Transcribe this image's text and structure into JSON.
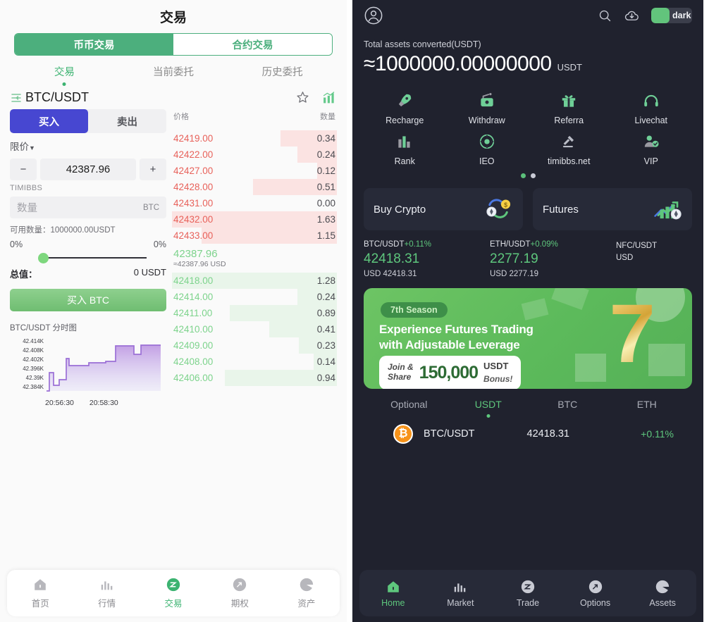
{
  "left": {
    "title": "交易",
    "segments": [
      {
        "label": "币币交易",
        "active": true
      },
      {
        "label": "合约交易",
        "active": false
      }
    ],
    "subtabs": [
      {
        "label": "交易",
        "active": true
      },
      {
        "label": "当前委托",
        "active": false
      },
      {
        "label": "历史委托",
        "active": false
      }
    ],
    "pair": "BTC/USDT",
    "icons": {
      "back": "back-arrow-icon",
      "favorite": "star-outline-icon",
      "kline": "kline-chart-icon"
    },
    "form": {
      "buy_label": "买入",
      "sell_label": "卖出",
      "order_type": "限价",
      "minus": "−",
      "plus": "+",
      "price_value": "42387.96",
      "brand": "TIMIBBS",
      "qty_placeholder": "数量",
      "qty_unit": "BTC",
      "available_label": "可用数量：1000000.00USDT",
      "pct_left": "0%",
      "pct_right": "0%",
      "total_label": "总值：",
      "total_value": "0 USDT",
      "cta": "买入 BTC"
    },
    "chart": {
      "title": "BTC/USDT 分时图",
      "time_labels": [
        "20:56:30",
        "20:58:30"
      ]
    },
    "orderbook": {
      "head_price": "价格",
      "head_qty": "数量",
      "asks": [
        {
          "price": "42419.00",
          "qty": "0.34",
          "depth": 34
        },
        {
          "price": "42422.00",
          "qty": "0.24",
          "depth": 24
        },
        {
          "price": "42427.00",
          "qty": "0.12",
          "depth": 12
        },
        {
          "price": "42428.00",
          "qty": "0.51",
          "depth": 51
        },
        {
          "price": "42431.00",
          "qty": "0.00",
          "depth": 0
        },
        {
          "price": "42432.00",
          "qty": "1.63",
          "depth": 100
        },
        {
          "price": "42433.00",
          "qty": "1.15",
          "depth": 82
        }
      ],
      "mid_price": "42387.96",
      "mid_usd": "≈42387.96 USD",
      "bids": [
        {
          "price": "42418.00",
          "qty": "1.28",
          "depth": 100
        },
        {
          "price": "42414.00",
          "qty": "0.24",
          "depth": 24
        },
        {
          "price": "42411.00",
          "qty": "0.89",
          "depth": 65
        },
        {
          "price": "42410.00",
          "qty": "0.41",
          "depth": 41
        },
        {
          "price": "42409.00",
          "qty": "0.23",
          "depth": 23
        },
        {
          "price": "42408.00",
          "qty": "0.14",
          "depth": 14
        },
        {
          "price": "42406.00",
          "qty": "0.94",
          "depth": 68
        }
      ]
    },
    "bottom_nav": [
      {
        "label": "首页",
        "icon": "home-icon",
        "active": false
      },
      {
        "label": "行情",
        "icon": "bars-chart-icon",
        "active": false
      },
      {
        "label": "交易",
        "icon": "trade-circle-icon",
        "active": true
      },
      {
        "label": "期权",
        "icon": "options-arrow-icon",
        "active": false
      },
      {
        "label": "资产",
        "icon": "pie-chart-icon",
        "active": false
      }
    ]
  },
  "right": {
    "topbar": {
      "avatar": "user-avatar-icon",
      "search": "search-icon",
      "download": "download-cloud-icon",
      "theme_label": "dark"
    },
    "assets": {
      "label": "Total assets converted(USDT)",
      "value": "≈1000000.00000000",
      "unit": "USDT"
    },
    "quick_actions": [
      {
        "label": "Recharge",
        "icon": "rocket-icon"
      },
      {
        "label": "Withdraw",
        "icon": "withdraw-wallet-icon"
      },
      {
        "label": "Referra",
        "icon": "gift-icon"
      },
      {
        "label": "Livechat",
        "icon": "headset-icon"
      },
      {
        "label": "Rank",
        "icon": "rank-bars-icon"
      },
      {
        "label": "IEO",
        "icon": "atom-icon"
      },
      {
        "label": "timibbs.net",
        "icon": "gavel-icon"
      },
      {
        "label": "VIP",
        "icon": "vip-user-icon"
      }
    ],
    "carousel_dots": [
      true,
      false
    ],
    "cards": [
      {
        "title": "Buy Crypto",
        "icon": "swap-coins-icon"
      },
      {
        "title": "Futures",
        "icon": "futures-growth-icon"
      }
    ],
    "tickers": [
      {
        "pair": "BTC/USDT",
        "change": "+0.11%",
        "price": "42418.31",
        "sub": "USD 42418.31"
      },
      {
        "pair": "ETH/USDT",
        "change": "+0.09%",
        "price": "2277.19",
        "sub": "USD 2277.19"
      },
      {
        "pair": "NFC/USDT",
        "change": "",
        "price": "",
        "sub": "USD"
      }
    ],
    "banner": {
      "badge": "7th Season",
      "headline_line1": "Experience Futures Trading",
      "headline_line2": "with Adjustable Leverage",
      "join": "Join &",
      "share": "Share",
      "amount": "150,000",
      "usdt": "USDT",
      "bonus": "Bonus!",
      "seven": "7"
    },
    "market_tabs": [
      {
        "label": "Optional",
        "active": false
      },
      {
        "label": "USDT",
        "active": true
      },
      {
        "label": "BTC",
        "active": false
      },
      {
        "label": "ETH",
        "active": false
      }
    ],
    "coins": [
      {
        "symbol": "₿",
        "name": "BTC/USDT",
        "price": "42418.31",
        "change": "+0.11%"
      }
    ],
    "bottom_nav": [
      {
        "label": "Home",
        "icon": "home-icon",
        "active": true
      },
      {
        "label": "Market",
        "icon": "bars-chart-icon",
        "active": false
      },
      {
        "label": "Trade",
        "icon": "trade-circle-icon",
        "active": false
      },
      {
        "label": "Options",
        "icon": "options-arrow-icon",
        "active": false
      },
      {
        "label": "Assets",
        "icon": "pie-chart-icon",
        "active": false
      }
    ]
  },
  "colors": {
    "green": "#3cb371",
    "accent_green": "#5ec77d",
    "buy_blue": "#4747d1",
    "ask_red": "#e8625b",
    "dark_bg": "#20222e",
    "card_bg": "#272a38",
    "chart_line": "#9b6fd6"
  },
  "chart_data": {
    "type": "area",
    "title": "BTC/USDT 分时图",
    "ylabel": "",
    "xlabel": "",
    "y_ticks": [
      "42.384K",
      "42.39K",
      "42.396K",
      "42.402K",
      "42.408K",
      "42.414K"
    ],
    "x_ticks": [
      "20:56:30",
      "20:58:30"
    ],
    "ylim": [
      42.381,
      42.417
    ],
    "grid": false,
    "legend": "none",
    "series": [
      {
        "name": "BTC/USDT price",
        "values": [
          42.384,
          42.3845,
          42.392,
          42.392,
          42.386,
          42.386,
          42.389,
          42.389,
          42.4035,
          42.4005,
          42.4005,
          42.4005,
          42.4025,
          42.4025,
          42.4025,
          42.4035,
          42.4035,
          42.414,
          42.414,
          42.4075,
          42.4075,
          42.4145,
          42.4145
        ]
      }
    ]
  }
}
